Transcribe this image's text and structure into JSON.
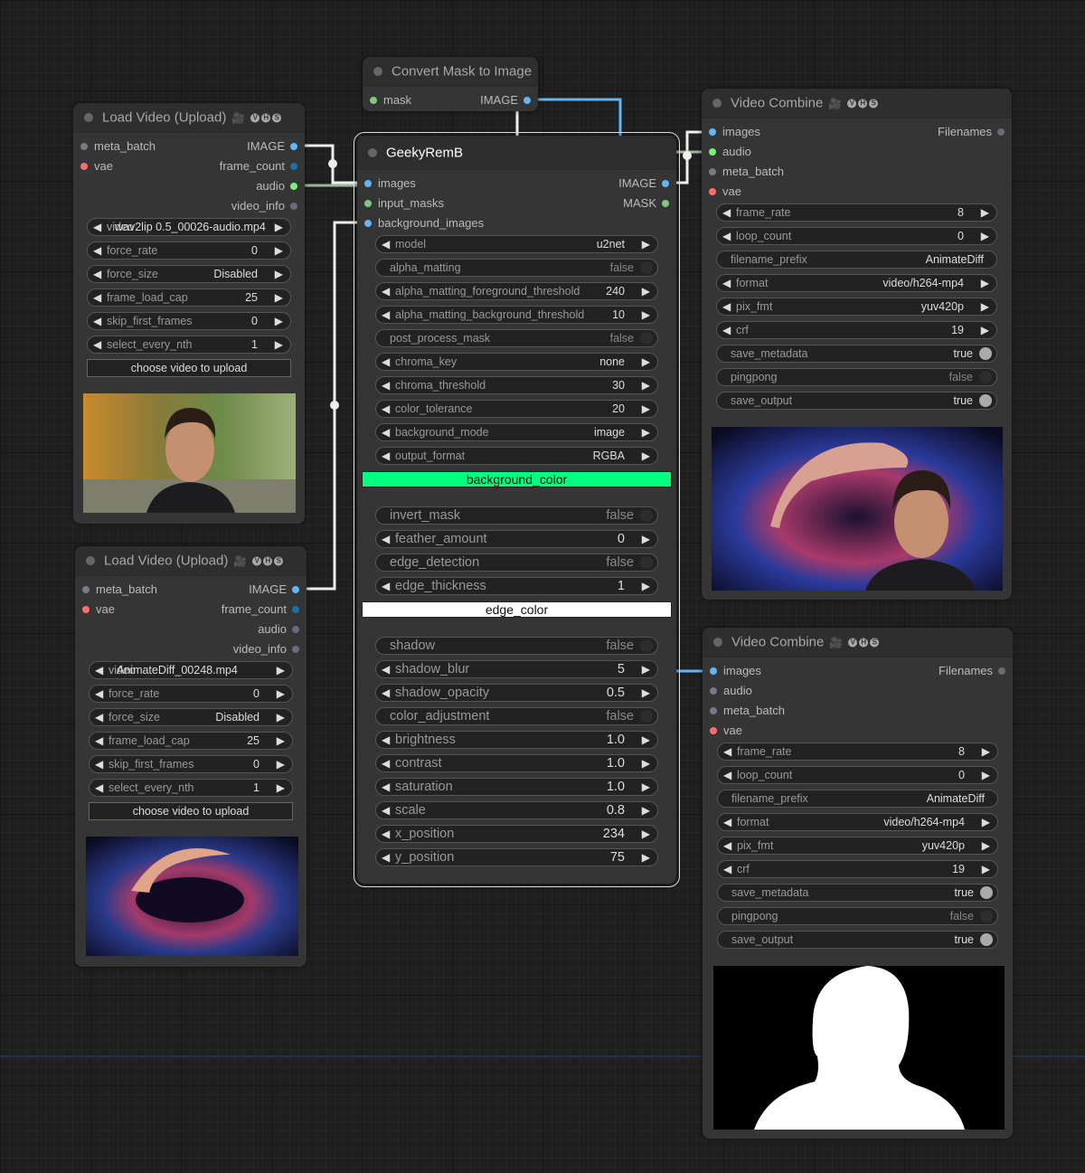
{
  "nodes": {
    "load_video_1": {
      "title": "Load Video (Upload)",
      "badges": [
        "V",
        "H",
        "S"
      ],
      "inputs": [
        {
          "label": "meta_batch",
          "color": "#7a7a88"
        },
        {
          "label": "vae",
          "color": "#ff6e6e"
        }
      ],
      "outputs": [
        {
          "label": "IMAGE",
          "color": "#64b5f6"
        },
        {
          "label": "frame_count",
          "color": "#1e6fa8"
        },
        {
          "label": "audio",
          "color": "#7cf07c"
        },
        {
          "label": "video_info",
          "color": "#6a6a78"
        }
      ],
      "widgets": [
        {
          "type": "combo",
          "label": "video",
          "value": "wav2lip 0.5_00026-audio.mp4"
        },
        {
          "type": "number",
          "label": "force_rate",
          "value": "0"
        },
        {
          "type": "combo",
          "label": "force_size",
          "value": "Disabled"
        },
        {
          "type": "number",
          "label": "frame_load_cap",
          "value": "25"
        },
        {
          "type": "number",
          "label": "skip_first_frames",
          "value": "0"
        },
        {
          "type": "number",
          "label": "select_every_nth",
          "value": "1"
        },
        {
          "type": "button",
          "label": "choose video to upload"
        }
      ]
    },
    "load_video_2": {
      "title": "Load Video (Upload)",
      "badges": [
        "V",
        "H",
        "S"
      ],
      "inputs": [
        {
          "label": "meta_batch",
          "color": "#7a7a88"
        },
        {
          "label": "vae",
          "color": "#ff6e6e"
        }
      ],
      "outputs": [
        {
          "label": "IMAGE",
          "color": "#64b5f6"
        },
        {
          "label": "frame_count",
          "color": "#1e6fa8"
        },
        {
          "label": "audio",
          "color": "#6a6a78"
        },
        {
          "label": "video_info",
          "color": "#6a6a78"
        }
      ],
      "widgets": [
        {
          "type": "combo",
          "label": "video",
          "value": "AnimateDiff_00248.mp4"
        },
        {
          "type": "number",
          "label": "force_rate",
          "value": "0"
        },
        {
          "type": "combo",
          "label": "force_size",
          "value": "Disabled"
        },
        {
          "type": "number",
          "label": "frame_load_cap",
          "value": "25"
        },
        {
          "type": "number",
          "label": "skip_first_frames",
          "value": "0"
        },
        {
          "type": "number",
          "label": "select_every_nth",
          "value": "1"
        },
        {
          "type": "button",
          "label": "choose video to upload"
        }
      ]
    },
    "convert_mask": {
      "title": "Convert Mask to Image",
      "inputs": [
        {
          "label": "mask",
          "color": "#81c784"
        }
      ],
      "outputs": [
        {
          "label": "IMAGE",
          "color": "#64b5f6"
        }
      ],
      "widgets": []
    },
    "geeky_remb": {
      "title": "GeekyRemB",
      "inputs": [
        {
          "label": "images",
          "color": "#64b5f6"
        },
        {
          "label": "input_masks",
          "color": "#81c784"
        },
        {
          "label": "background_images",
          "color": "#64b5f6"
        }
      ],
      "outputs": [
        {
          "label": "IMAGE",
          "color": "#64b5f6"
        },
        {
          "label": "MASK",
          "color": "#81c784"
        }
      ],
      "widgets": [
        {
          "type": "combo",
          "label": "model",
          "value": "u2net"
        },
        {
          "type": "toggle",
          "label": "alpha_matting",
          "value": "false"
        },
        {
          "type": "number",
          "label": "alpha_matting_foreground_threshold",
          "value": "240"
        },
        {
          "type": "number",
          "label": "alpha_matting_background_threshold",
          "value": "10"
        },
        {
          "type": "toggle",
          "label": "post_process_mask",
          "value": "false"
        },
        {
          "type": "combo",
          "label": "chroma_key",
          "value": "none"
        },
        {
          "type": "number",
          "label": "chroma_threshold",
          "value": "30"
        },
        {
          "type": "number",
          "label": "color_tolerance",
          "value": "20"
        },
        {
          "type": "combo",
          "label": "background_mode",
          "value": "image"
        },
        {
          "type": "combo",
          "label": "output_format",
          "value": "RGBA"
        },
        {
          "type": "colorbar",
          "label": "background_color",
          "color": "#00ff7f"
        },
        {
          "type": "toggle",
          "label": "invert_mask",
          "value": "false"
        },
        {
          "type": "number",
          "label": "feather_amount",
          "value": "0"
        },
        {
          "type": "toggle",
          "label": "edge_detection",
          "value": "false"
        },
        {
          "type": "number",
          "label": "edge_thickness",
          "value": "1"
        },
        {
          "type": "colorbar",
          "label": "edge_color",
          "color": "#ffffff"
        },
        {
          "type": "toggle",
          "label": "shadow",
          "value": "false"
        },
        {
          "type": "number",
          "label": "shadow_blur",
          "value": "5"
        },
        {
          "type": "number",
          "label": "shadow_opacity",
          "value": "0.5"
        },
        {
          "type": "toggle",
          "label": "color_adjustment",
          "value": "false"
        },
        {
          "type": "number",
          "label": "brightness",
          "value": "1.0"
        },
        {
          "type": "number",
          "label": "contrast",
          "value": "1.0"
        },
        {
          "type": "number",
          "label": "saturation",
          "value": "1.0"
        },
        {
          "type": "number",
          "label": "scale",
          "value": "0.8"
        },
        {
          "type": "number",
          "label": "x_position",
          "value": "234"
        },
        {
          "type": "number",
          "label": "y_position",
          "value": "75"
        }
      ]
    },
    "video_combine_1": {
      "title": "Video Combine",
      "badges": [
        "V",
        "H",
        "S"
      ],
      "inputs": [
        {
          "label": "images",
          "color": "#64b5f6"
        },
        {
          "label": "audio",
          "color": "#7cf07c"
        },
        {
          "label": "meta_batch",
          "color": "#7a7a88"
        },
        {
          "label": "vae",
          "color": "#ff6e6e"
        }
      ],
      "outputs": [
        {
          "label": "Filenames",
          "color": "#6a6a78"
        }
      ],
      "widgets": [
        {
          "type": "number",
          "label": "frame_rate",
          "value": "8"
        },
        {
          "type": "number",
          "label": "loop_count",
          "value": "0"
        },
        {
          "type": "text",
          "label": "filename_prefix",
          "value": "AnimateDiff"
        },
        {
          "type": "combo",
          "label": "format",
          "value": "video/h264-mp4"
        },
        {
          "type": "combo",
          "label": "pix_fmt",
          "value": "yuv420p"
        },
        {
          "type": "number",
          "label": "crf",
          "value": "19"
        },
        {
          "type": "toggle",
          "label": "save_metadata",
          "value": "true"
        },
        {
          "type": "toggle",
          "label": "pingpong",
          "value": "false"
        },
        {
          "type": "toggle",
          "label": "save_output",
          "value": "true"
        }
      ]
    },
    "video_combine_2": {
      "title": "Video Combine",
      "badges": [
        "V",
        "H",
        "S"
      ],
      "inputs": [
        {
          "label": "images",
          "color": "#64b5f6"
        },
        {
          "label": "audio",
          "color": "#7a7a88"
        },
        {
          "label": "meta_batch",
          "color": "#7a7a88"
        },
        {
          "label": "vae",
          "color": "#ff6e6e"
        }
      ],
      "outputs": [
        {
          "label": "Filenames",
          "color": "#6a6a78"
        }
      ],
      "widgets": [
        {
          "type": "number",
          "label": "frame_rate",
          "value": "8"
        },
        {
          "type": "number",
          "label": "loop_count",
          "value": "0"
        },
        {
          "type": "text",
          "label": "filename_prefix",
          "value": "AnimateDiff"
        },
        {
          "type": "combo",
          "label": "format",
          "value": "video/h264-mp4"
        },
        {
          "type": "combo",
          "label": "pix_fmt",
          "value": "yuv420p"
        },
        {
          "type": "number",
          "label": "crf",
          "value": "19"
        },
        {
          "type": "toggle",
          "label": "save_metadata",
          "value": "true"
        },
        {
          "type": "toggle",
          "label": "pingpong",
          "value": "false"
        },
        {
          "type": "toggle",
          "label": "save_output",
          "value": "true"
        }
      ]
    }
  }
}
